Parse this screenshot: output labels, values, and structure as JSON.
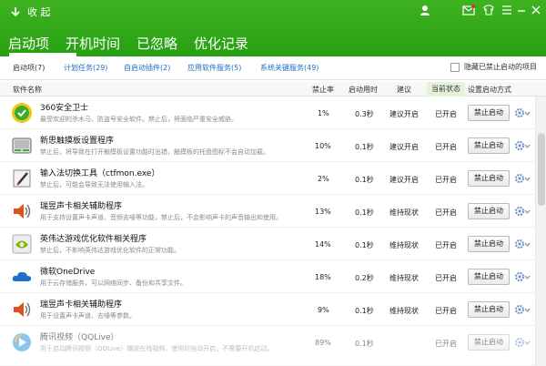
{
  "header": {
    "back_label": "收 起",
    "tabs": [
      {
        "label": "启动项",
        "active": true
      },
      {
        "label": "开机时间",
        "active": false
      },
      {
        "label": "已忽略",
        "active": false
      },
      {
        "label": "优化记录",
        "active": false
      }
    ]
  },
  "subtabs": {
    "items": [
      {
        "label": "启动项(7)"
      },
      {
        "label": "计划任务(29)"
      },
      {
        "label": "自启动插件(2)"
      },
      {
        "label": "应用软件服务(5)"
      },
      {
        "label": "系统关键服务(49)"
      }
    ],
    "hide_disabled_label": "隐藏已禁止启动的项目"
  },
  "columns": {
    "name": "软件名称",
    "disable_rate": "禁止率",
    "boot_time": "启动用时",
    "advice": "建议",
    "status": "当前状态",
    "setting": "设置启动方式"
  },
  "rows": [
    {
      "icon": "360-security-icon",
      "name": "360安全卫士",
      "desc": "最受欢迎的杀木马、防盗号安全软件。禁止后，将面临严重安全威胁。",
      "rate": "1%",
      "time": "0.3秒",
      "advice": "建议开启",
      "status": "已开启",
      "button": "禁止启动"
    },
    {
      "icon": "touchpad-icon",
      "name": "新思触摸板设置程序",
      "desc": "禁止后，将导致在打开触摸板设置功能时出错，触摸板的托盘图标不会自动加载。",
      "rate": "10%",
      "time": "0.1秒",
      "advice": "建议开启",
      "status": "已开启",
      "button": "禁止启动"
    },
    {
      "icon": "input-method-icon",
      "name": "输入法切换工具（ctfmon.exe）",
      "desc": "禁止后，可能会导致无法使用输入法。",
      "rate": "2%",
      "time": "0.1秒",
      "advice": "建议开启",
      "status": "已开启",
      "button": "禁止启动"
    },
    {
      "icon": "speaker-icon",
      "name": "瑞昱声卡相关辅助程序",
      "desc": "用于支持设置声卡声道、音频去噪等功能，禁止后，不会影响声卡的声音输出和使用。",
      "rate": "13%",
      "time": "0.1秒",
      "advice": "维持现状",
      "status": "已开启",
      "button": "禁止启动"
    },
    {
      "icon": "nvidia-icon",
      "name": "英伟达游戏优化软件相关程序",
      "desc": "禁止后，不影响英伟达游戏优化软件的正常功能。",
      "rate": "14%",
      "time": "0.1秒",
      "advice": "维持现状",
      "status": "已开启",
      "button": "禁止启动"
    },
    {
      "icon": "onedrive-icon",
      "name": "微软OneDrive",
      "desc": "用于云存储服务，可以网络同步、备份和共享文件。",
      "rate": "18%",
      "time": "0.2秒",
      "advice": "维持现状",
      "status": "已开启",
      "button": "禁止启动"
    },
    {
      "icon": "speaker-icon",
      "name": "瑞昱声卡相关辅助程序",
      "desc": "用于设置声卡声道、去噪等参数。",
      "rate": "9%",
      "time": "0.1秒",
      "advice": "维持现状",
      "status": "已开启",
      "button": "禁止启动"
    },
    {
      "icon": "tencent-video-icon",
      "name": "腾讯视频（QQLive）",
      "desc": "用于启动腾讯视频（QQLive）播放在线视频，使用时自动开启，不需要开机启动。",
      "rate": "89%",
      "time": "0.1秒",
      "advice": "",
      "status": "已开启",
      "button": "禁止启动"
    }
  ],
  "colors": {
    "header_green": "#2fa818",
    "link_blue": "#1d6fbf"
  }
}
